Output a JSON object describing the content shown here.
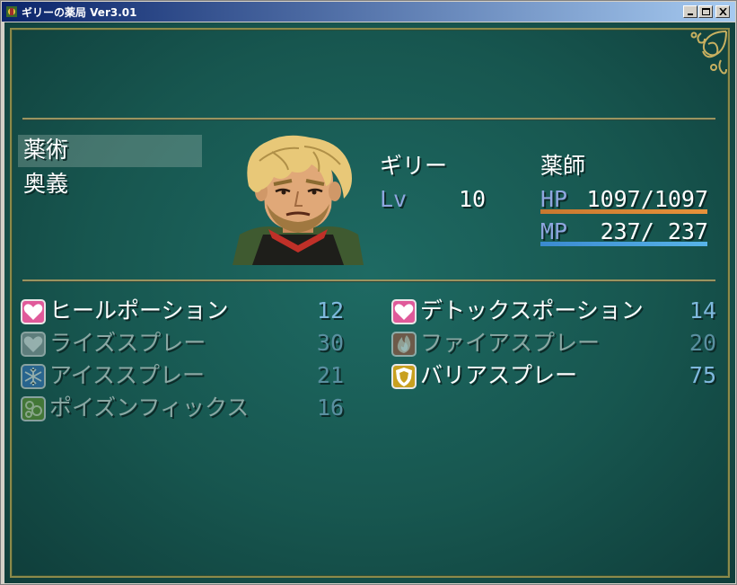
{
  "window": {
    "title": "ギリーの薬局 Ver3.01"
  },
  "menu": {
    "commands": [
      {
        "label": "薬術",
        "selected": true
      },
      {
        "label": "奥義",
        "selected": false
      }
    ]
  },
  "actor": {
    "name": "ギリー",
    "class": "薬師",
    "level_label": "Lv",
    "level": "10",
    "hp_label": "HP",
    "hp_value": "1097/1097",
    "hp_ratio": 1.0,
    "mp_label": "MP",
    "mp_value": "237/ 237",
    "mp_ratio": 1.0
  },
  "skills": [
    {
      "name": "ヒールポーション",
      "count": "12",
      "icon": "heart-icon",
      "enabled": true,
      "color": "#e05a9a"
    },
    {
      "name": "デトックスポーション",
      "count": "14",
      "icon": "heart-icon",
      "enabled": true,
      "color": "#e05a9a"
    },
    {
      "name": "ライズスプレー",
      "count": "30",
      "icon": "heart-icon",
      "enabled": false,
      "color": "#9aa4a6"
    },
    {
      "name": "ファイアスプレー",
      "count": "20",
      "icon": "fire-icon",
      "enabled": false,
      "color": "#b0533a"
    },
    {
      "name": "アイススプレー",
      "count": "21",
      "icon": "snowflake-icon",
      "enabled": false,
      "color": "#3a78c8"
    },
    {
      "name": "バリアスプレー",
      "count": "75",
      "icon": "shield-icon",
      "enabled": true,
      "color": "#c8a020"
    },
    {
      "name": "ポイズンフィックス",
      "count": "16",
      "icon": "poison-bubbles-icon",
      "enabled": false,
      "color": "#6a9a2a"
    }
  ],
  "colors": {
    "hp_gauge": "#e8923a",
    "mp_gauge": "#58b4e8",
    "stat_label": "#8fa6df",
    "count_text": "#7fb8dd"
  }
}
